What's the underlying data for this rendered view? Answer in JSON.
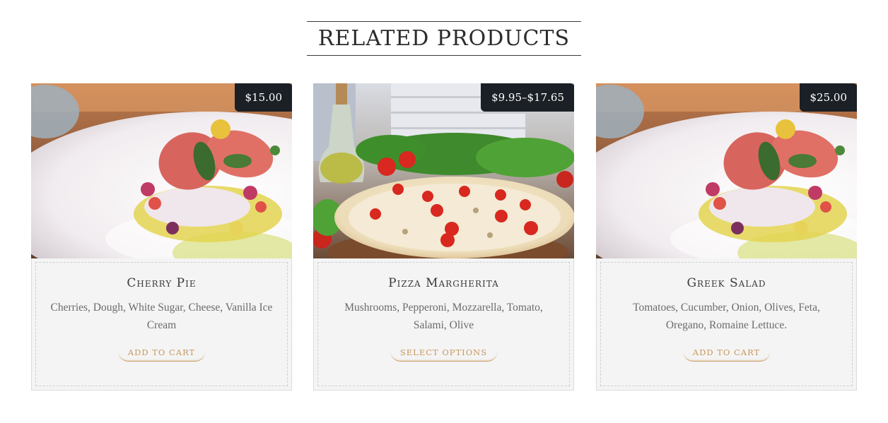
{
  "section": {
    "title": "RELATED PRODUCTS"
  },
  "products": [
    {
      "name": "Cherry Pie",
      "price": "$15.00",
      "description": "Cherries, Dough, White Sugar, Cheese, Vanilla Ice Cream",
      "button_label": "ADD TO CART",
      "image": "plated-meat-dish-photo"
    },
    {
      "name": "Pizza Margherita",
      "price": "$9.95–$17.65",
      "description": "Mushrooms, Pepperoni, Mozzarella, Tomato, Salami, Olive",
      "button_label": "SELECT OPTIONS",
      "image": "pizza-photo"
    },
    {
      "name": "Greek Salad",
      "price": "$25.00",
      "description": "Tomatoes, Cucumber, Onion, Olives, Feta, Oregano, Romaine Lettuce.",
      "button_label": "ADD TO CART",
      "image": "plated-meat-dish-photo"
    }
  ],
  "colors": {
    "accent": "#c9975a",
    "badge_background": "#1b2026",
    "card_background": "#f4f4f4",
    "title_text": "#2b2b2b",
    "body_text": "#6b6b6b"
  }
}
